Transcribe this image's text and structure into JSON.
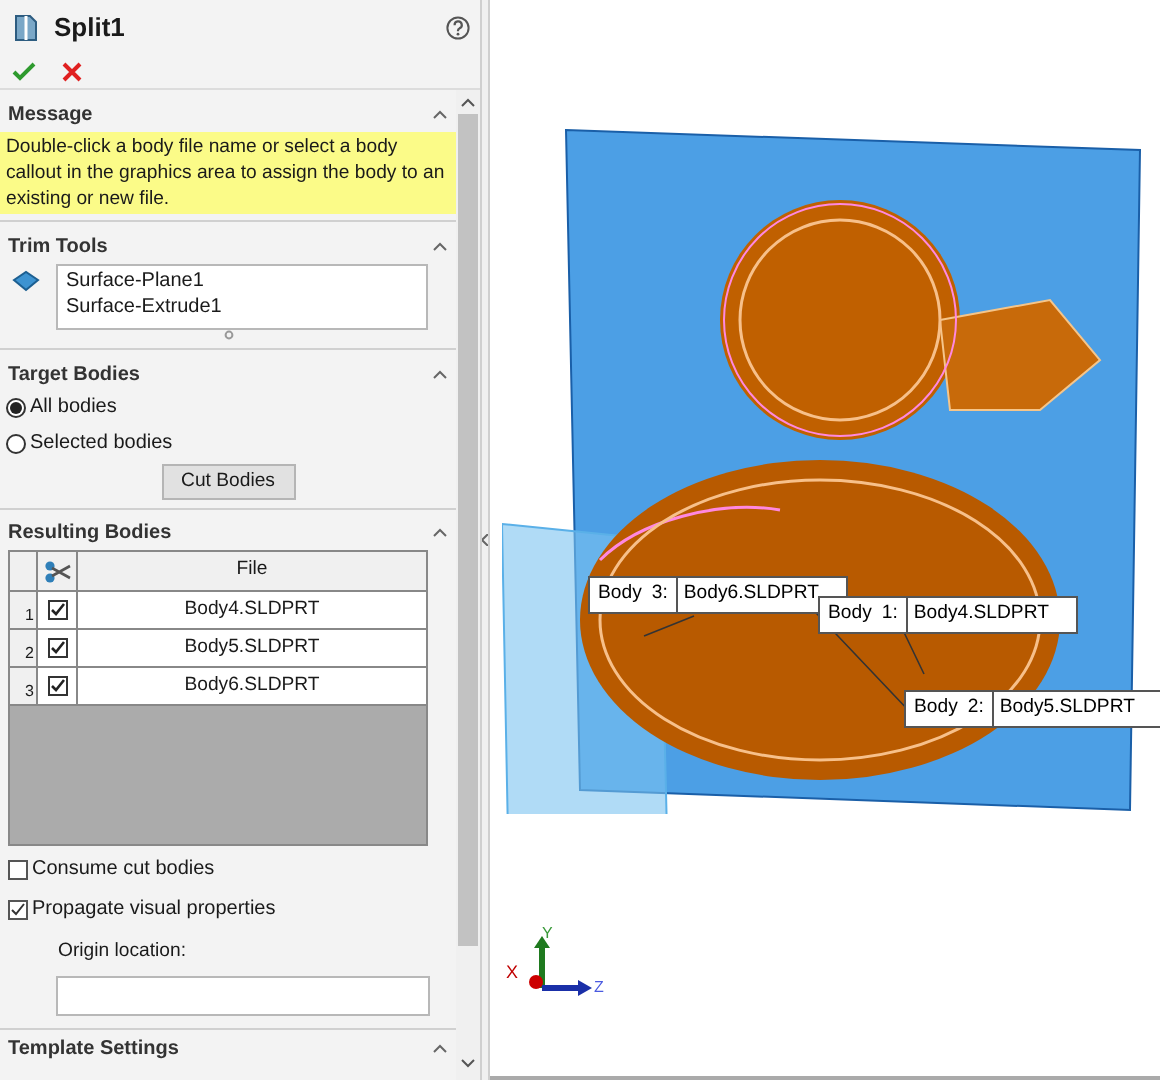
{
  "panel": {
    "title": "Split1"
  },
  "message": {
    "header": "Message",
    "text": "Double-click a body file name or select a body callout in the graphics area to assign the body to an existing or new file."
  },
  "trim_tools": {
    "header": "Trim Tools",
    "items": [
      "Surface-Plane1",
      "Surface-Extrude1"
    ]
  },
  "target_bodies": {
    "header": "Target Bodies",
    "options": [
      {
        "label": "All bodies",
        "selected": true
      },
      {
        "label": "Selected bodies",
        "selected": false
      }
    ],
    "button": "Cut Bodies"
  },
  "resulting_bodies": {
    "header": "Resulting Bodies",
    "column": "File",
    "rows": [
      {
        "number": "1",
        "checked": true,
        "file": "Body4.SLDPRT"
      },
      {
        "number": "2",
        "checked": true,
        "file": "Body5.SLDPRT"
      },
      {
        "number": "3",
        "checked": true,
        "file": "Body6.SLDPRT"
      }
    ]
  },
  "options": [
    {
      "label": "Consume cut bodies",
      "checked": false
    },
    {
      "label": "Propagate visual properties",
      "checked": true
    }
  ],
  "origin_location": {
    "label": "Origin location:"
  },
  "template_settings": {
    "header": "Template Settings"
  },
  "callouts": [
    {
      "label": "Body",
      "number": "3:",
      "file": "Body6.SLDPRT"
    },
    {
      "label": "Body",
      "number": "1:",
      "file": "Body4.SLDPRT"
    },
    {
      "label": "Body",
      "number": "2:",
      "file": "Body5.SLDPRT"
    }
  ],
  "triad": {
    "x": "X",
    "y": "Y",
    "z": "Z"
  }
}
